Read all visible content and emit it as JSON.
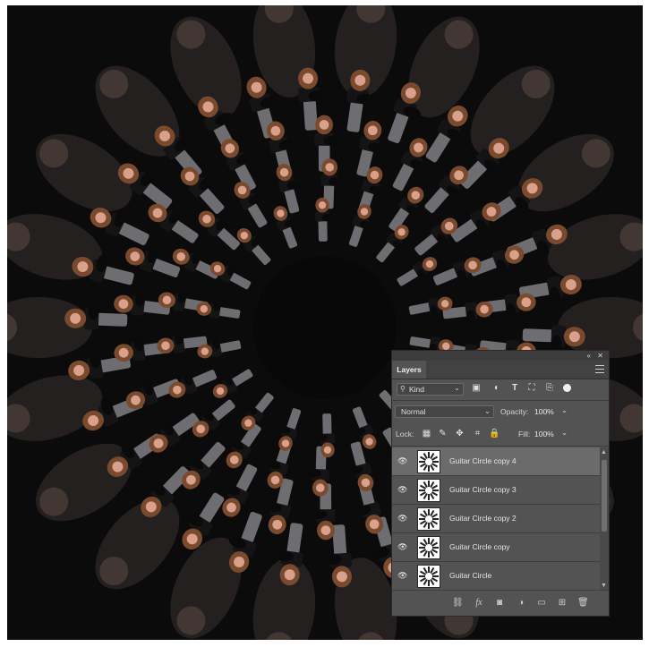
{
  "panel": {
    "tab_label": "Layers",
    "collapse_icon": "collapse-icon",
    "close_icon": "close-icon",
    "menu_icon": "panel-menu-icon"
  },
  "filter": {
    "kind_label": "Kind",
    "icons": [
      "pixel-filter-icon",
      "adjustment-filter-icon",
      "type-filter-icon",
      "shape-filter-icon",
      "smart-object-filter-icon"
    ]
  },
  "blend": {
    "mode": "Normal",
    "opacity_label": "Opacity:",
    "opacity_value": "100%"
  },
  "lock": {
    "label": "Lock:",
    "icons": [
      "lock-transparent-icon",
      "lock-image-icon",
      "lock-position-icon",
      "lock-artboard-icon",
      "lock-all-icon"
    ],
    "fill_label": "Fill:",
    "fill_value": "100%"
  },
  "layers": [
    {
      "name": "Guitar Circle copy 4",
      "selected": true
    },
    {
      "name": "Guitar Circle copy 3",
      "selected": false
    },
    {
      "name": "Guitar Circle copy 2",
      "selected": false
    },
    {
      "name": "Guitar Circle copy",
      "selected": false
    },
    {
      "name": "Guitar Circle",
      "selected": false
    }
  ],
  "bottom_icons": [
    "link-layers-icon",
    "fx-icon",
    "mask-icon",
    "adjustment-layer-icon",
    "group-folder-icon",
    "new-layer-icon",
    "trash-icon"
  ],
  "colors": {
    "canvas_bg": "#0b0b0b",
    "panel_bg": "#535353",
    "selected_row": "#6b6b6b"
  }
}
